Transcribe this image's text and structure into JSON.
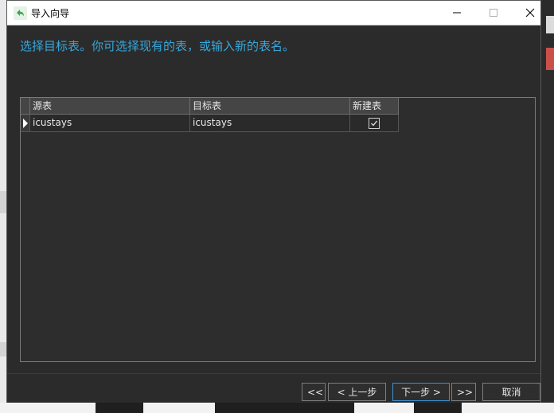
{
  "window": {
    "title": "导入向导",
    "controls": {
      "minimize": "minimize",
      "maximize": "maximize",
      "close": "close"
    }
  },
  "instruction": "选择目标表。你可选择现有的表，或输入新的表名。",
  "table": {
    "columns": [
      "源表",
      "目标表",
      "新建表"
    ],
    "rows": [
      {
        "source": "icustays",
        "target": "icustays",
        "new_table": true
      }
    ]
  },
  "buttons": {
    "first": "<<",
    "prev": "< 上一步",
    "next": "下一步 >",
    "last": ">>",
    "cancel": "取消"
  },
  "colors": {
    "accent": "#38a6d9",
    "window_bg": "#2b2b2b",
    "focus_border": "#3d8fd1"
  }
}
